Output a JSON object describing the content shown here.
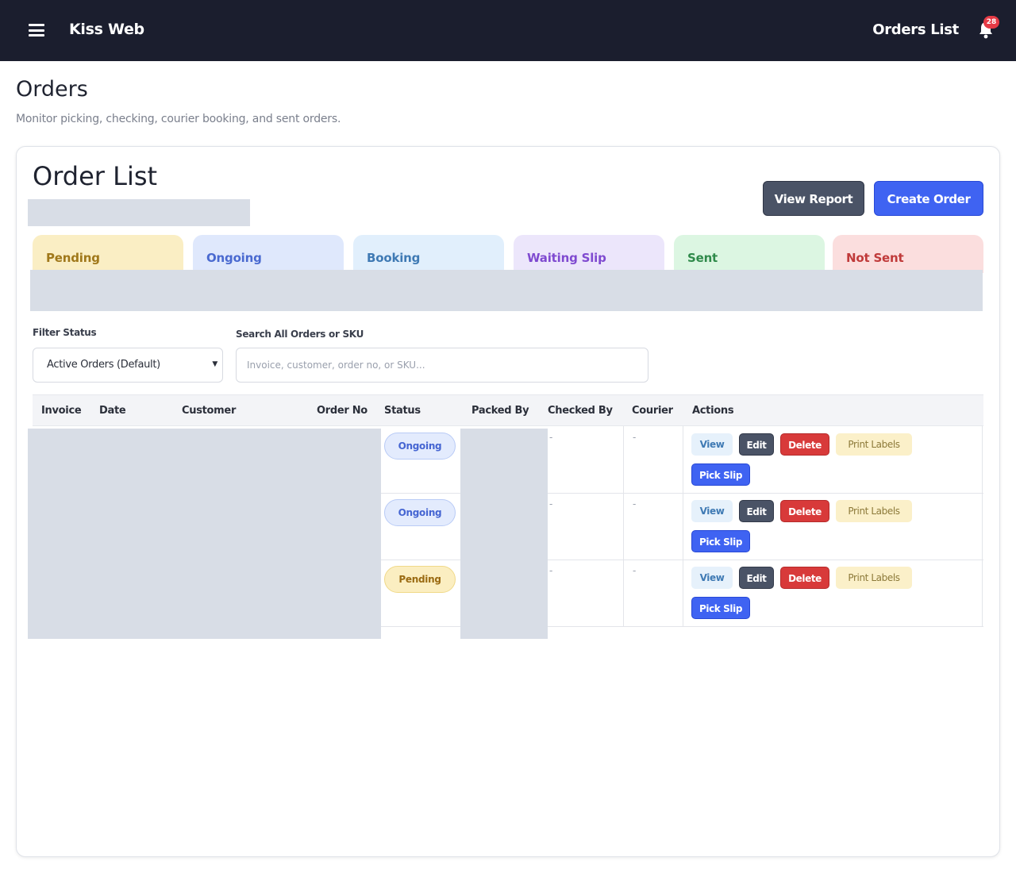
{
  "topbar": {
    "brand": "Kiss Web",
    "title": "Orders List",
    "notification_count": "28"
  },
  "page": {
    "title": "Orders",
    "subtitle": "Monitor picking, checking, courier booking, and sent orders."
  },
  "card": {
    "title": "Order List",
    "view_report_label": "View Report",
    "create_order_label": "Create Order"
  },
  "tabs": [
    {
      "label": "Pending",
      "bg": "#faeec4",
      "color": "#a0781a"
    },
    {
      "label": "Ongoing",
      "bg": "#dfe8fc",
      "color": "#4a6ad0"
    },
    {
      "label": "Booking",
      "bg": "#e1effc",
      "color": "#3f7ab4"
    },
    {
      "label": "Waiting Slip",
      "bg": "#ece6fb",
      "color": "#7f4ad0"
    },
    {
      "label": "Sent",
      "bg": "#dcf6e2",
      "color": "#2f8a4a"
    },
    {
      "label": "Not Sent",
      "bg": "#fbdede",
      "color": "#c03a3a"
    }
  ],
  "filters": {
    "status_label": "Filter Status",
    "status_value": "Active Orders (Default)",
    "search_label": "Search All Orders or SKU",
    "search_placeholder": "Invoice, customer, order no, or SKU..."
  },
  "table": {
    "columns": [
      "Invoice",
      "Date",
      "Customer",
      "Order No",
      "Status",
      "Packed By",
      "Checked By",
      "Courier",
      "Actions"
    ],
    "rows": [
      {
        "status": "Ongoing",
        "checked_by": "-",
        "courier": "-"
      },
      {
        "status": "Ongoing",
        "checked_by": "-",
        "courier": "-"
      },
      {
        "status": "Pending",
        "checked_by": "-",
        "courier": "-"
      }
    ],
    "actions": {
      "view": "View",
      "edit": "Edit",
      "delete": "Delete",
      "print": "Print Labels",
      "pick": "Pick Slip"
    }
  },
  "colors": {
    "topbar": "#1b1e2e",
    "primary": "#3f63f2",
    "danger": "#d83a3a",
    "secondary": "#4a5366"
  }
}
